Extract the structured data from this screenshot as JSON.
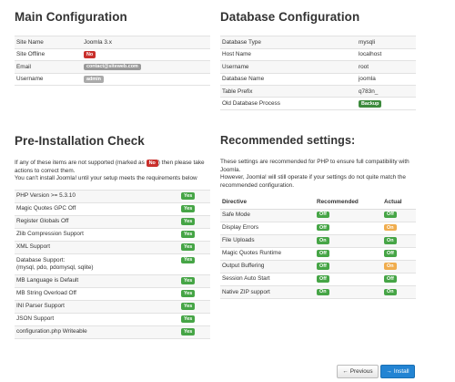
{
  "main_config": {
    "title": "Main Configuration",
    "rows": [
      {
        "label": "Site Name",
        "value": "Joomla 3.x",
        "kind": "text"
      },
      {
        "label": "Site Offline",
        "value": "No",
        "kind": "badge-red"
      },
      {
        "label": "Email",
        "value": "contact@siteweb.com",
        "kind": "badge-gray"
      },
      {
        "label": "Username",
        "value": "admin",
        "kind": "badge-gray"
      }
    ]
  },
  "db_config": {
    "title": "Database Configuration",
    "rows": [
      {
        "label": "Database Type",
        "value": "mysqli"
      },
      {
        "label": "Host Name",
        "value": "localhost"
      },
      {
        "label": "Username",
        "value": "root"
      },
      {
        "label": "Database Name",
        "value": "joomla"
      },
      {
        "label": "Table Prefix",
        "value": "q783n_"
      },
      {
        "label": "Old Database Process",
        "value": "Backup"
      }
    ]
  },
  "preinstall": {
    "title": "Pre-Installation Check",
    "intro_part1": "If any of these items are not supported (marked as",
    "intro_badge": "No",
    "intro_part2": ") then please take actions to correct them.",
    "intro_line2": "You can't install Joomla! until your setup meets the requirements below",
    "checks": [
      {
        "label": "PHP Version >= 5.3.10",
        "status": "Yes"
      },
      {
        "label": "Magic Quotes GPC Off",
        "status": "Yes"
      },
      {
        "label": "Register Globals Off",
        "status": "Yes"
      },
      {
        "label": "Zlib Compression Support",
        "status": "Yes"
      },
      {
        "label": "XML Support",
        "status": "Yes"
      },
      {
        "label": "Database Support:",
        "sub": "(mysql, pdo, pdomysql, sqlite)",
        "status": "Yes"
      },
      {
        "label": "MB Language is Default",
        "status": "Yes"
      },
      {
        "label": "MB String Overload Off",
        "status": "Yes"
      },
      {
        "label": "INI Parser Support",
        "status": "Yes"
      },
      {
        "label": "JSON Support",
        "status": "Yes"
      },
      {
        "label": "configuration.php Writeable",
        "status": "Yes"
      }
    ]
  },
  "recommended": {
    "title": "Recommended settings:",
    "intro": "These settings are recommended for PHP to ensure full compatibility with Joomla.",
    "intro2": "However, Joomla! will still operate if your settings do not quite match the recommended configuration.",
    "headers": {
      "directive": "Directive",
      "recommended": "Recommended",
      "actual": "Actual"
    },
    "rows": [
      {
        "directive": "Safe Mode",
        "recommended": "Off",
        "actual": "Off",
        "actual_ok": true
      },
      {
        "directive": "Display Errors",
        "recommended": "Off",
        "actual": "On",
        "actual_ok": false
      },
      {
        "directive": "File Uploads",
        "recommended": "On",
        "actual": "On",
        "actual_ok": true
      },
      {
        "directive": "Magic Quotes Runtime",
        "recommended": "Off",
        "actual": "Off",
        "actual_ok": true
      },
      {
        "directive": "Output Buffering",
        "recommended": "Off",
        "actual": "On",
        "actual_ok": false
      },
      {
        "directive": "Session Auto Start",
        "recommended": "Off",
        "actual": "Off",
        "actual_ok": true
      },
      {
        "directive": "Native ZIP support",
        "recommended": "On",
        "actual": "On",
        "actual_ok": true
      }
    ]
  },
  "footer": {
    "previous_label": "Previous",
    "previous_icon": "arrow-left-icon",
    "install_label": "Install",
    "install_icon": "arrow-right-icon"
  },
  "colors": {
    "success": "#46a546",
    "danger": "#c9302c",
    "warning": "#f0ad4e",
    "primary": "#2384d3"
  }
}
